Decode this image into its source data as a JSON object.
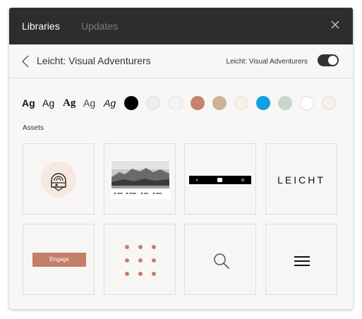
{
  "header": {
    "tabs": [
      {
        "label": "Libraries",
        "active": true
      },
      {
        "label": "Updates",
        "active": false
      }
    ]
  },
  "library": {
    "title": "Leicht: Visual Adventurers",
    "toggle_label": "Leicht: Visual Adventurers",
    "toggle_on": true
  },
  "text_styles": [
    {
      "label": "Ag",
      "style": "bold"
    },
    {
      "label": "Ag",
      "style": "medium"
    },
    {
      "label": "Ag",
      "style": "bold-serif"
    },
    {
      "label": "Ag",
      "style": "light"
    },
    {
      "label": "Ag",
      "style": "italic"
    }
  ],
  "colors": [
    "#000000",
    "#eeeeee",
    "#f4f4f4",
    "#c4836a",
    "#cdb29a",
    "#f7f0e4",
    "#0f9fe2",
    "#c5d8cc",
    "#ffffff",
    "#f3f0ec"
  ],
  "assets_label": "Assets",
  "assets": [
    {
      "type": "logo-emblem-image"
    },
    {
      "type": "landscape-webpage-image"
    },
    {
      "type": "navigation-bar-image"
    },
    {
      "type": "wordmark",
      "text": "LEICHT"
    },
    {
      "type": "button",
      "text": "Engage",
      "color": "#c47f67"
    },
    {
      "type": "dots-grid-icon",
      "color": "#c47f67"
    },
    {
      "type": "search-icon"
    },
    {
      "type": "hamburger-menu-icon"
    }
  ]
}
